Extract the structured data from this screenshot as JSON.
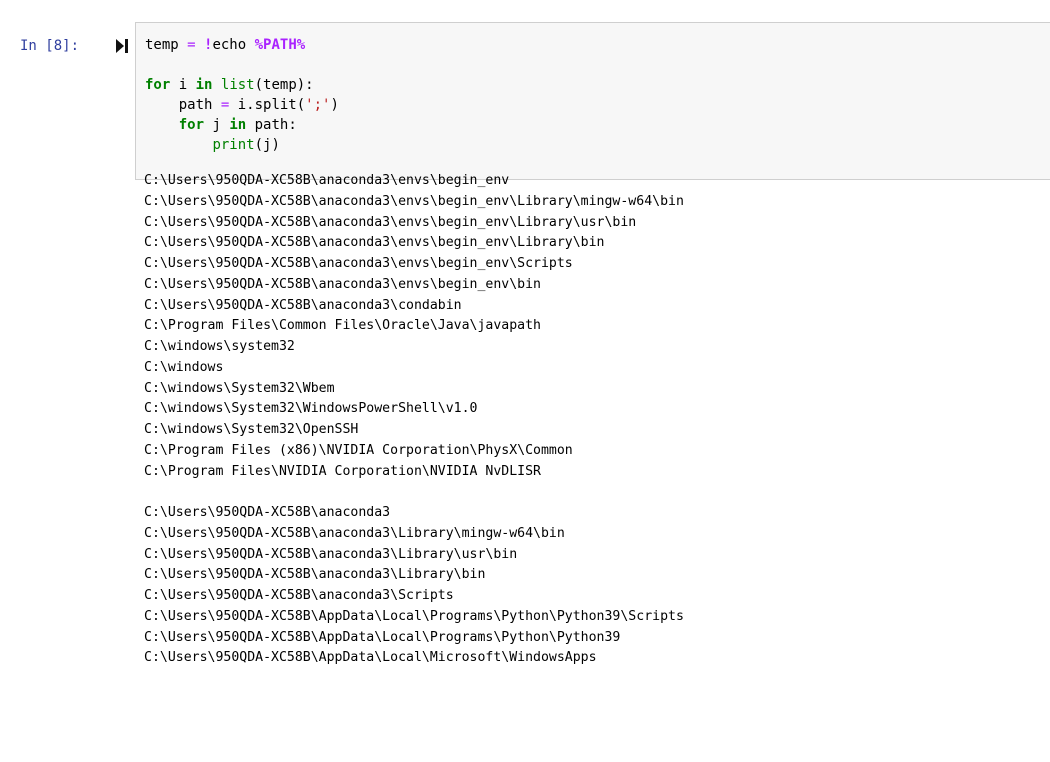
{
  "cell": {
    "prompt": "In [8]:",
    "code_tokens": {
      "l1_var": "temp",
      "l1_eq": " = ",
      "l1_bang": "!",
      "l1_cmd": "echo ",
      "l1_var1": "%PATH%",
      "l3_for": "for",
      "l3_i": " i ",
      "l3_in": "in",
      "l3_sp": " ",
      "l3_list": "list",
      "l3_rest": "(temp):",
      "l4_indent": "    ",
      "l4_path": "path",
      "l4_eq": " = ",
      "l4_call": "i.split(",
      "l4_str": "';'",
      "l4_close": ")",
      "l5_indent": "    ",
      "l5_for": "for",
      "l5_j": " j ",
      "l5_in": "in",
      "l5_rest": " path:",
      "l6_indent": "        ",
      "l6_print": "print",
      "l6_rest": "(j)"
    },
    "output_lines": [
      "C:\\Users\\950QDA-XC58B\\anaconda3\\envs\\begin_env",
      "C:\\Users\\950QDA-XC58B\\anaconda3\\envs\\begin_env\\Library\\mingw-w64\\bin",
      "C:\\Users\\950QDA-XC58B\\anaconda3\\envs\\begin_env\\Library\\usr\\bin",
      "C:\\Users\\950QDA-XC58B\\anaconda3\\envs\\begin_env\\Library\\bin",
      "C:\\Users\\950QDA-XC58B\\anaconda3\\envs\\begin_env\\Scripts",
      "C:\\Users\\950QDA-XC58B\\anaconda3\\envs\\begin_env\\bin",
      "C:\\Users\\950QDA-XC58B\\anaconda3\\condabin",
      "C:\\Program Files\\Common Files\\Oracle\\Java\\javapath",
      "C:\\windows\\system32",
      "C:\\windows",
      "C:\\windows\\System32\\Wbem",
      "C:\\windows\\System32\\WindowsPowerShell\\v1.0",
      "C:\\windows\\System32\\OpenSSH",
      "C:\\Program Files (x86)\\NVIDIA Corporation\\PhysX\\Common",
      "C:\\Program Files\\NVIDIA Corporation\\NVIDIA NvDLISR",
      "",
      "C:\\Users\\950QDA-XC58B\\anaconda3",
      "C:\\Users\\950QDA-XC58B\\anaconda3\\Library\\mingw-w64\\bin",
      "C:\\Users\\950QDA-XC58B\\anaconda3\\Library\\usr\\bin",
      "C:\\Users\\950QDA-XC58B\\anaconda3\\Library\\bin",
      "C:\\Users\\950QDA-XC58B\\anaconda3\\Scripts",
      "C:\\Users\\950QDA-XC58B\\AppData\\Local\\Programs\\Python\\Python39\\Scripts",
      "C:\\Users\\950QDA-XC58B\\AppData\\Local\\Programs\\Python\\Python39",
      "C:\\Users\\950QDA-XC58B\\AppData\\Local\\Microsoft\\WindowsApps"
    ]
  },
  "icons": {
    "run": "run-cell-icon"
  },
  "colors": {
    "prompt": "#303f9f",
    "keyword": "#008000",
    "operator": "#aa22ff",
    "string": "#ba2121",
    "input_bg": "#f7f7f7",
    "input_border": "#cfcfcf"
  }
}
